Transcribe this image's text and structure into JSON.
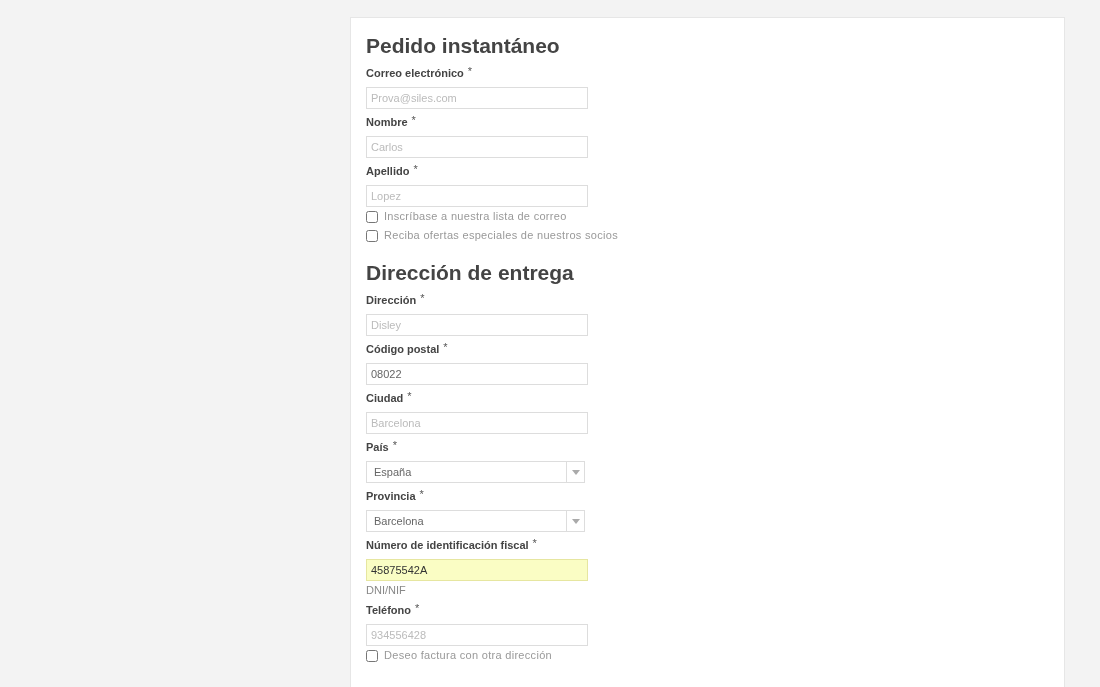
{
  "sections": [
    {
      "title": "Pedido instantáneo",
      "fields": [
        {
          "kind": "input",
          "label": "Correo electrónico",
          "mark": "*",
          "placeholder": "Prova@siles.com"
        },
        {
          "kind": "input",
          "label": "Nombre",
          "mark": "*",
          "placeholder": "Carlos"
        },
        {
          "kind": "input",
          "label": "Apellido",
          "mark": "*",
          "placeholder": "Lopez"
        },
        {
          "kind": "checkbox",
          "label": "Inscríbase a nuestra lista de correo",
          "checked": false
        },
        {
          "kind": "checkbox",
          "label": "Reciba ofertas especiales de nuestros socios",
          "checked": false
        }
      ]
    },
    {
      "title": "Dirección de entrega",
      "fields": [
        {
          "kind": "input",
          "label": "Dirección",
          "mark": "*",
          "placeholder": "Disley"
        },
        {
          "kind": "input",
          "label": "Código postal",
          "mark": "*",
          "value": "08022"
        },
        {
          "kind": "input",
          "label": "Ciudad",
          "mark": "*",
          "placeholder": "Barcelona"
        },
        {
          "kind": "select",
          "label": "País",
          "mark": "*",
          "value": "España"
        },
        {
          "kind": "select",
          "label": "Provincia",
          "mark": "*",
          "value": "Barcelona"
        },
        {
          "kind": "input",
          "label": "Número de identificación fiscal",
          "mark": "*",
          "value": "45875542A",
          "highlighted": true,
          "hint": "DNI/NIF"
        },
        {
          "kind": "input",
          "label": "Teléfono",
          "mark": "*",
          "placeholder": "934556428"
        },
        {
          "kind": "checkbox",
          "label": "Deseo factura con otra dirección",
          "checked": false
        }
      ]
    }
  ]
}
